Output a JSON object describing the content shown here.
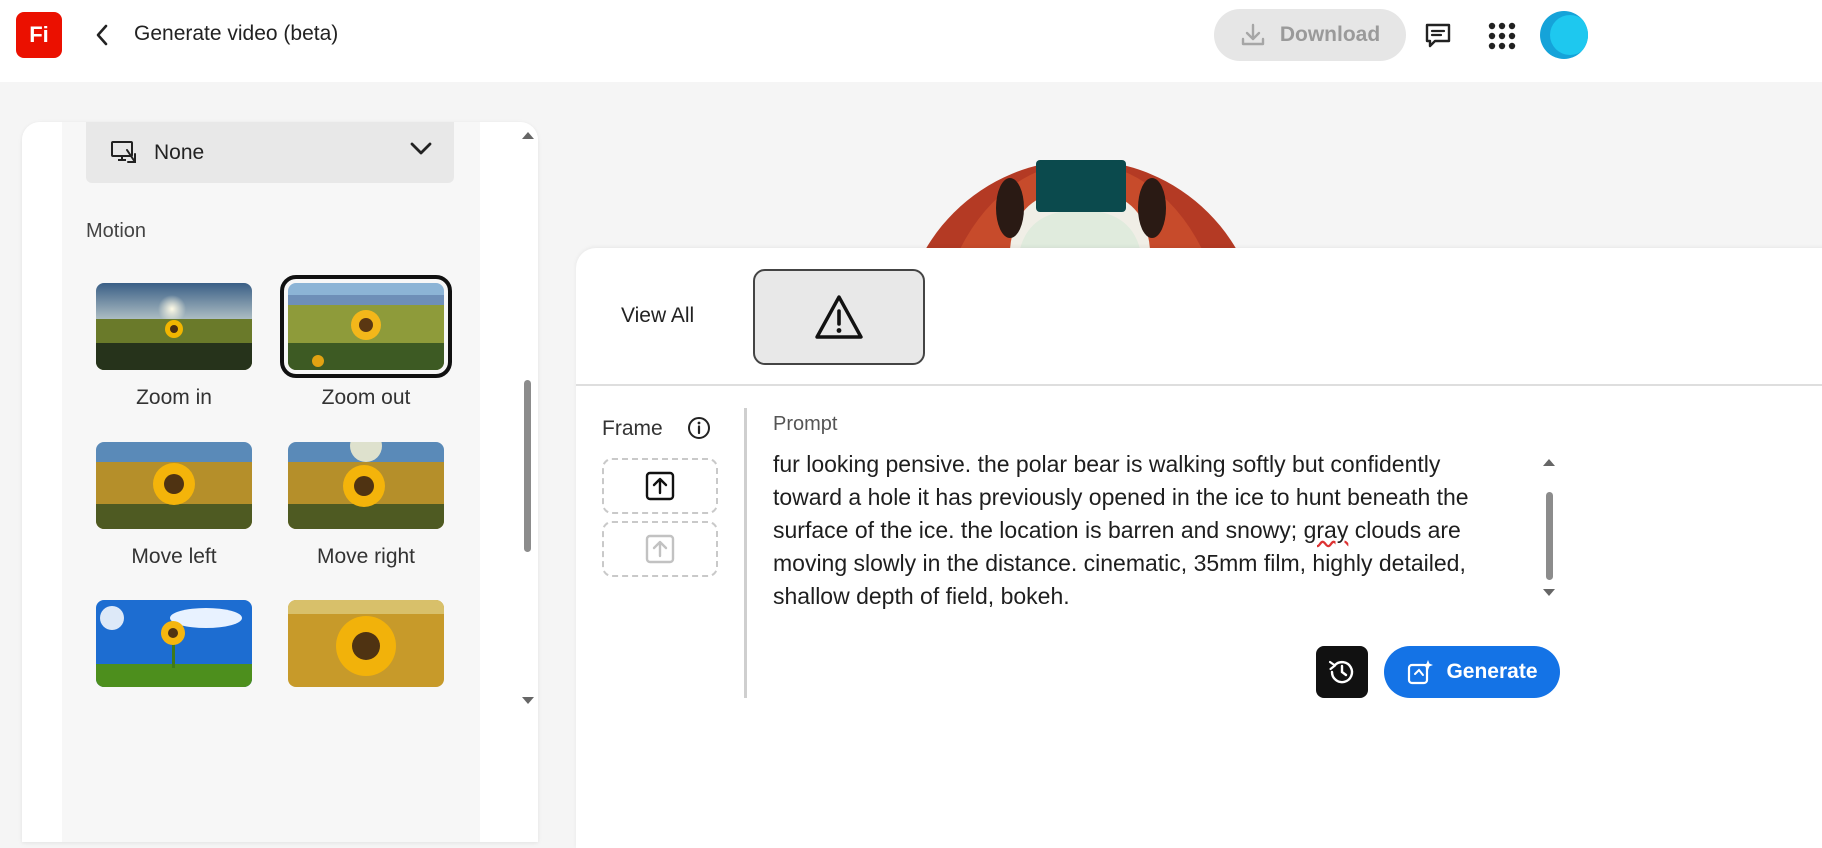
{
  "header": {
    "app_logo_text": "Fi",
    "title": "Generate video (beta)",
    "download_label": "Download"
  },
  "sidebar": {
    "camera_angle_value": "None",
    "motion_label": "Motion",
    "motion_options": [
      {
        "label": "Zoom in"
      },
      {
        "label": "Zoom out",
        "selected": true
      },
      {
        "label": "Move left"
      },
      {
        "label": "Move right"
      },
      {
        "label": ""
      },
      {
        "label": ""
      }
    ]
  },
  "panel": {
    "view_all_label": "View All",
    "frame_label": "Frame",
    "prompt_label": "Prompt",
    "prompt_text_before": "fur looking pensive. the polar bear is walking softly but confidently toward a hole it has previously opened in the ice to hunt beneath the surface of the ice. the location is barren and snowy; ",
    "prompt_text_flagged": "gray",
    "prompt_text_after": " clouds are moving slowly in the distance. cinematic, 35mm film, highly detailed, shallow depth of field, bokeh.",
    "generate_label": "Generate"
  },
  "colors": {
    "accent": "#1473e6",
    "logo": "#eb1000"
  }
}
